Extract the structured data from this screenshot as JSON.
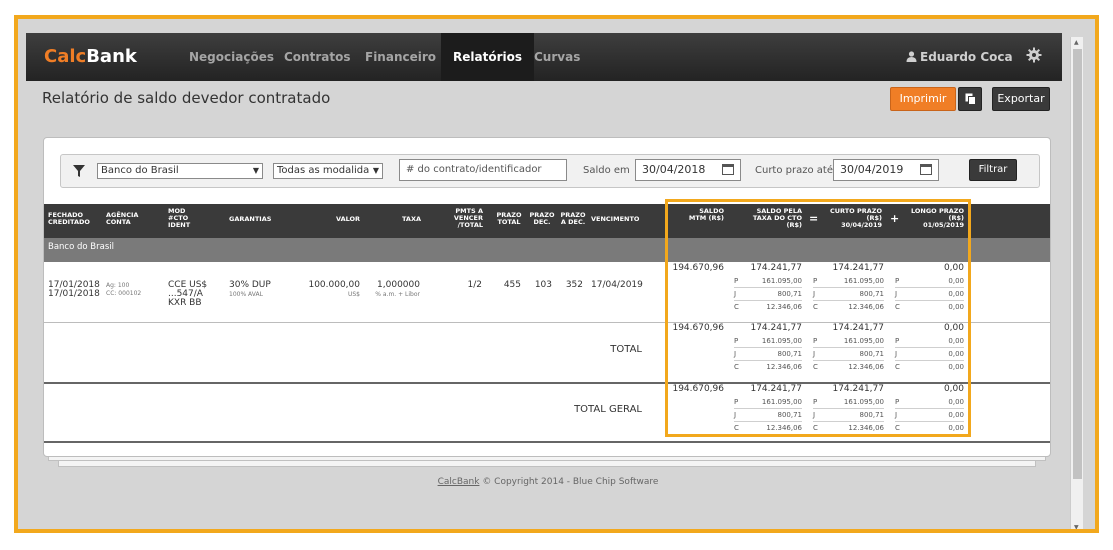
{
  "app": {
    "logo_left": "Calc",
    "logo_right": "Bank",
    "nav": [
      "Negociações",
      "Contratos",
      "Financeiro",
      "Relatórios",
      "Curvas"
    ],
    "user": "Eduardo Coca",
    "gear_icon": "gear-icon",
    "user_icon": "user-icon"
  },
  "page": {
    "title": "Relatório de saldo devedor contratado",
    "print_label": "Imprimir",
    "export_label": "Exportar"
  },
  "filters": {
    "bank": "Banco do Brasil",
    "modality": "Todas as modalida",
    "contract_placeholder": "# do contrato/identificador",
    "saldo_label": "Saldo em",
    "saldo_date": "30/04/2018",
    "curto_label": "Curto prazo até",
    "curto_date": "30/04/2019",
    "filter_label": "Filtrar"
  },
  "table": {
    "headers": {
      "fechado": "FECHADO CREDITADO",
      "agencia": "AGÊNCIA CONTA",
      "mod": "MOD #CTO IDENT",
      "garantias": "GARANTIAS",
      "valor": "VALOR",
      "taxa": "TAXA",
      "pmts": "PMTS A VENCER /TOTAL",
      "prazo_total": "PRAZO TOTAL",
      "prazo_dec": "PRAZO DEC.",
      "prazo_adec": "PRAZO A DEC.",
      "vencimento": "VENCIMENTO",
      "saldo_mtm": "SALDO MTM (R$)",
      "saldo_taxa": "SALDO PELA TAXA DO CTO (R$)",
      "curto": "CURTO PRAZO (R$) 30/04/2019",
      "longo": "LONGO PRAZO (R$) 01/05/2019"
    },
    "group": "Banco do Brasil",
    "row": {
      "fechado": "17/01/2018",
      "creditado": "17/01/2018",
      "ag": "Ag: 100",
      "cc": "CC: 000102",
      "mod1": "CCE US$",
      "mod2": "...547/A",
      "mod3": "KXR BB",
      "garantia": "30% DUP",
      "garantia_sub": "100% AVAL",
      "valor": "100.000,00",
      "valor_sub": "US$",
      "taxa": "1,000000",
      "taxa_sub": "% a.m. + Libor",
      "pmts": "1/2",
      "prazo_total": "455",
      "prazo_dec": "103",
      "prazo_adec": "352",
      "vencimento": "17/04/2019"
    },
    "total_label": "TOTAL",
    "total_geral_label": "TOTAL GERAL",
    "values": {
      "mtm": "194.670,96",
      "saldo": "174.241,77",
      "p": "161.095,00",
      "j": "800,71",
      "c": "12.346,06",
      "curto": "174.241,77",
      "curto_p": "161.095,00",
      "curto_j": "800,71",
      "curto_c": "12.346,06",
      "longo": "0,00",
      "longo_p": "0,00",
      "longo_j": "0,00",
      "longo_c": "0,00"
    },
    "letters": {
      "p": "P",
      "j": "J",
      "c": "C"
    },
    "equals": "=",
    "plus": "+"
  },
  "footer": {
    "brand": "CalcBank",
    "text": "© Copyright 2014 - Blue Chip Software"
  }
}
